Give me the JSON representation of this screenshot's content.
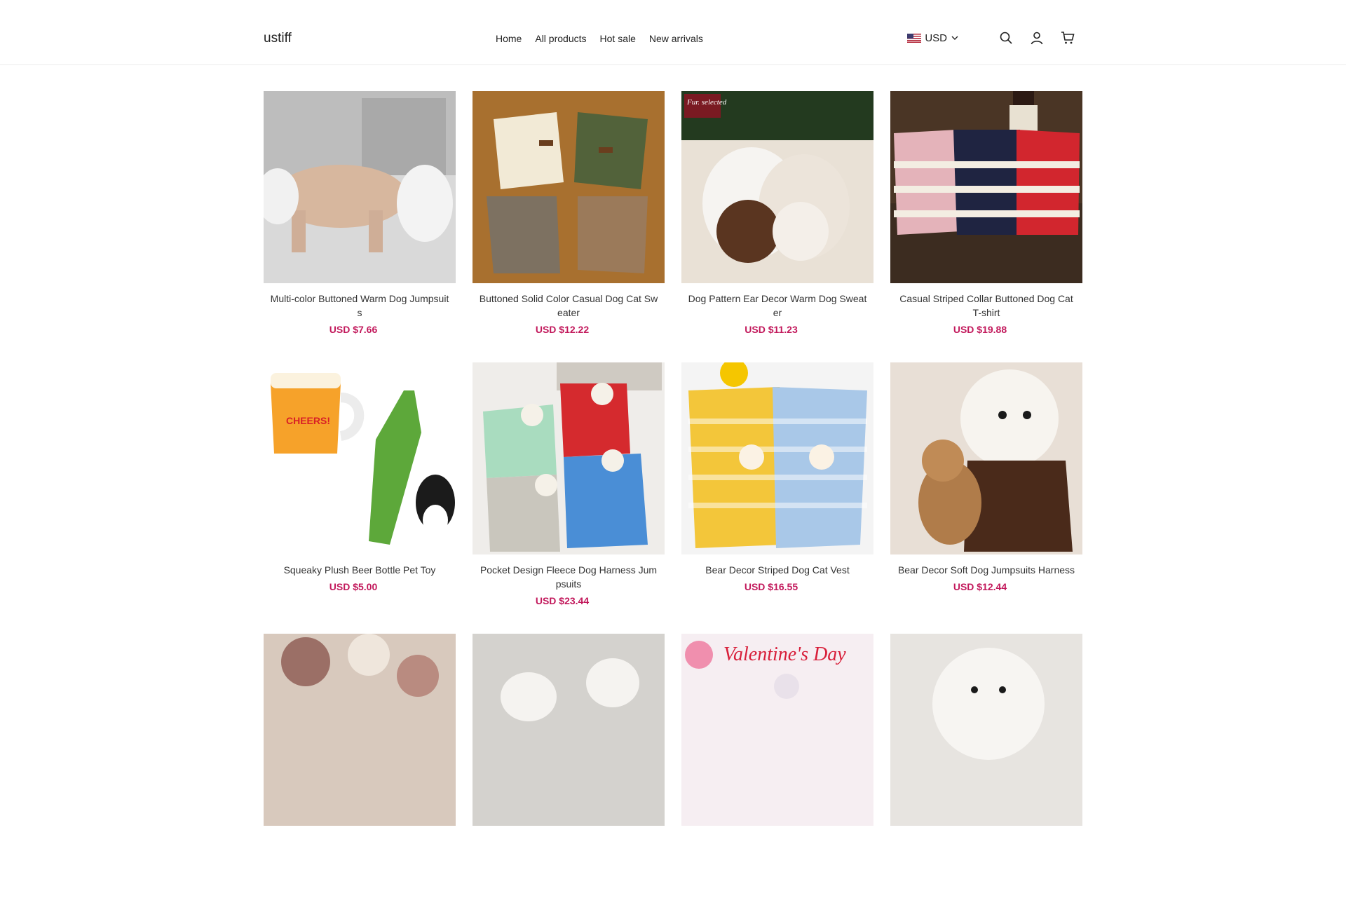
{
  "header": {
    "logo": "ustiff",
    "nav": [
      "Home",
      "All products",
      "Hot sale",
      "New arrivals"
    ],
    "currency": "USD",
    "icons": [
      "us-flag-icon",
      "chevron-down-icon",
      "search-icon",
      "user-icon",
      "cart-icon"
    ]
  },
  "colors": {
    "price": "#c2185b",
    "divider": "#ececec"
  },
  "products": [
    {
      "title": "Multi-color Buttoned Warm Dog Jumpsuits",
      "price": "USD $7.66"
    },
    {
      "title": "Buttoned Solid Color Casual Dog Cat Sweater",
      "price": "USD $12.22"
    },
    {
      "title": "Dog Pattern Ear Decor Warm Dog Sweater",
      "price": "USD $11.23",
      "image_text": "Fur. selected"
    },
    {
      "title": "Casual Striped Collar Buttoned Dog Cat T-shirt",
      "price": "USD $19.88"
    },
    {
      "title": "Squeaky Plush Beer Bottle Pet Toy",
      "price": "USD $5.00",
      "image_text": "CHEERS!"
    },
    {
      "title": "Pocket Design Fleece Dog Harness Jumpsuits",
      "price": "USD $23.44"
    },
    {
      "title": "Bear Decor Striped Dog Cat Vest",
      "price": "USD $16.55"
    },
    {
      "title": "Bear Decor Soft Dog Jumpsuits Harness",
      "price": "USD $12.44"
    },
    {
      "title": "",
      "price": ""
    },
    {
      "title": "",
      "price": ""
    },
    {
      "title": "",
      "price": "",
      "image_text": "Valentine's Day"
    },
    {
      "title": "",
      "price": ""
    }
  ]
}
